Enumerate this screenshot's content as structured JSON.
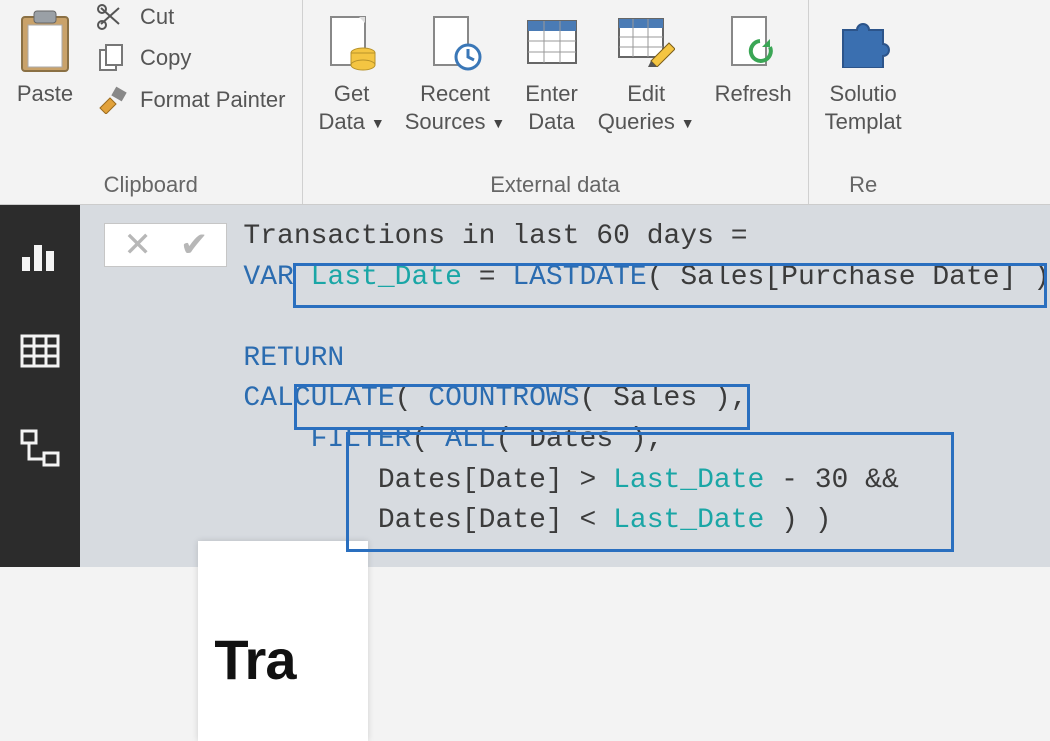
{
  "ribbon": {
    "paste": "Paste",
    "cut": "Cut",
    "copy": "Copy",
    "format_painter": "Format Painter",
    "clipboard_group": "Clipboard",
    "get_data_l1": "Get",
    "get_data_l2": "Data",
    "recent_l1": "Recent",
    "recent_l2": "Sources",
    "enter_l1": "Enter",
    "enter_l2": "Data",
    "edit_l1": "Edit",
    "edit_l2": "Queries",
    "refresh": "Refresh",
    "external_group": "External data",
    "sol_l1": "Solutio",
    "sol_l2": "Templat",
    "res_group": "Re"
  },
  "canvas": {
    "visual_title": "Tra"
  },
  "formula": {
    "line1": "Transactions in last 60 days =",
    "kw_var": "VAR",
    "var_name": "Last_Date",
    "eq": " = ",
    "fn_lastdate": "LASTDATE",
    "arg_lastdate": "( Sales[Purchase Date] )",
    "kw_return": "RETURN",
    "fn_calculate": "CALCULATE",
    "open_calc": "( ",
    "fn_countrows": "COUNTROWS",
    "arg_countrows": "( Sales ),",
    "indent_filter": "    ",
    "fn_filter": "FILTER",
    "open_filter": "( ",
    "fn_all": "ALL",
    "arg_all": "( Dates ),",
    "indent_cond": "        ",
    "cond1_lhs": "Dates[Date] > ",
    "cond1_mid": " - 30 &&",
    "cond2_lhs": "Dates[Date] < ",
    "close_all": " ) )"
  }
}
